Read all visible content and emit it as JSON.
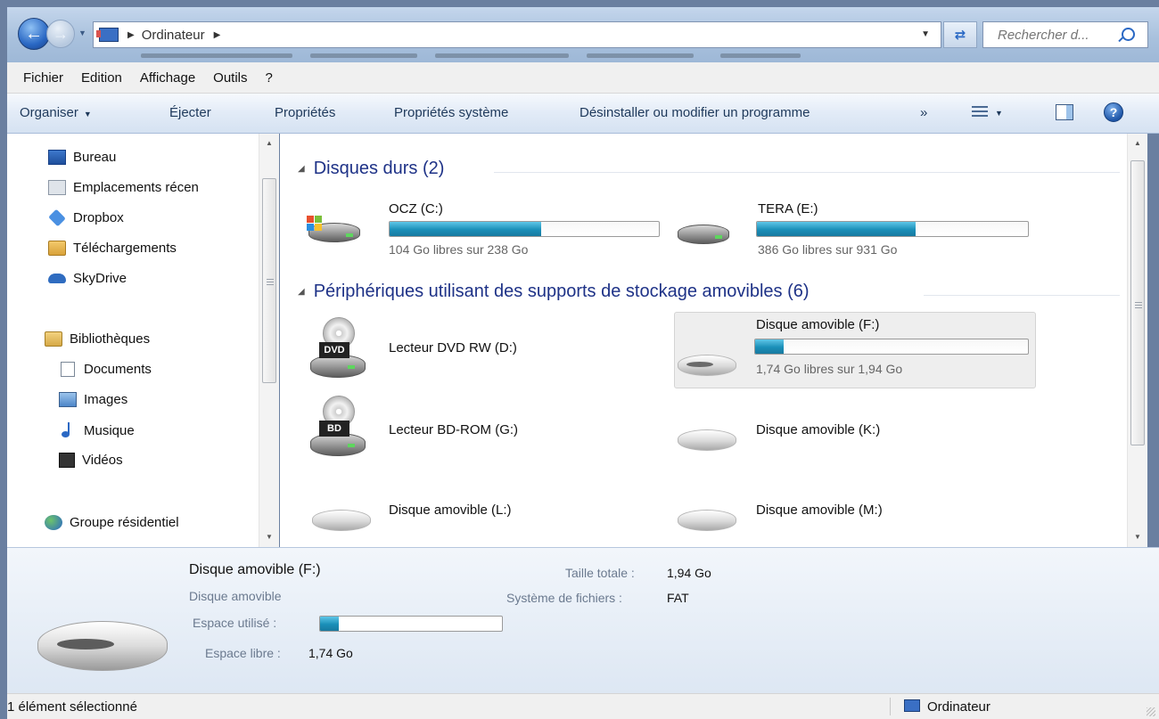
{
  "address_bar": {
    "path": "Ordinateur",
    "search_placeholder": "Rechercher d..."
  },
  "menu_bar": {
    "items": [
      "Fichier",
      "Edition",
      "Affichage",
      "Outils",
      "?"
    ]
  },
  "command_bar": {
    "organize": "Organiser",
    "eject": "Éjecter",
    "properties": "Propriétés",
    "system_properties": "Propriétés système",
    "uninstall": "Désinstaller ou modifier un programme",
    "more": "»"
  },
  "nav_pane": {
    "favorites": [
      "Bureau",
      "Emplacements récen",
      "Dropbox",
      "Téléchargements",
      "SkyDrive"
    ],
    "libraries_header": "Bibliothèques",
    "libraries": [
      "Documents",
      "Images",
      "Musique",
      "Vidéos"
    ],
    "homegroup": "Groupe résidentiel",
    "icons": {
      "favorites": [
        "desktop-icon",
        "recent-places-icon",
        "dropbox-icon",
        "downloads-folder-icon",
        "skydrive-icon"
      ],
      "libraries_header": "libraries-icon",
      "libraries": [
        "documents-icon",
        "images-icon",
        "music-icon",
        "videos-icon"
      ],
      "homegroup": "homegroup-icon"
    }
  },
  "groups": {
    "hard_disks": {
      "title": "Disques durs (2)",
      "drives": [
        {
          "name": "OCZ (C:)",
          "free_text": "104 Go libres sur 238 Go",
          "used_fraction": 0.563
        },
        {
          "name": "TERA (E:)",
          "free_text": "386 Go libres sur 931 Go",
          "used_fraction": 0.585
        }
      ]
    },
    "removable": {
      "title": "Périphériques utilisant des supports de stockage amovibles (6)",
      "devices": [
        {
          "name": "Lecteur DVD RW (D:)",
          "icon_label": "DVD"
        },
        {
          "name": "Disque amovible (F:)",
          "free_text": "1,74 Go libres sur 1,94 Go",
          "used_fraction": 0.103,
          "selected": true
        },
        {
          "name": "Lecteur BD-ROM (G:)",
          "icon_label": "BD"
        },
        {
          "name": "Disque amovible (K:)"
        },
        {
          "name": "Disque amovible (L:)"
        },
        {
          "name": "Disque amovible (M:)"
        }
      ]
    }
  },
  "details": {
    "title": "Disque amovible (F:)",
    "type": "Disque amovible",
    "used_label": "Espace utilisé :",
    "used_fraction": 0.103,
    "free_label": "Espace libre :",
    "free_value": "1,74 Go",
    "total_label": "Taille totale :",
    "total_value": "1,94 Go",
    "fs_label": "Système de fichiers :",
    "fs_value": "FAT"
  },
  "status_bar": {
    "selection": "1 élément sélectionné",
    "location": "Ordinateur"
  },
  "colors": {
    "accent": "#1e3287",
    "bar_fill": "#1a8fb8",
    "titlebar": "#a9c1dd"
  }
}
